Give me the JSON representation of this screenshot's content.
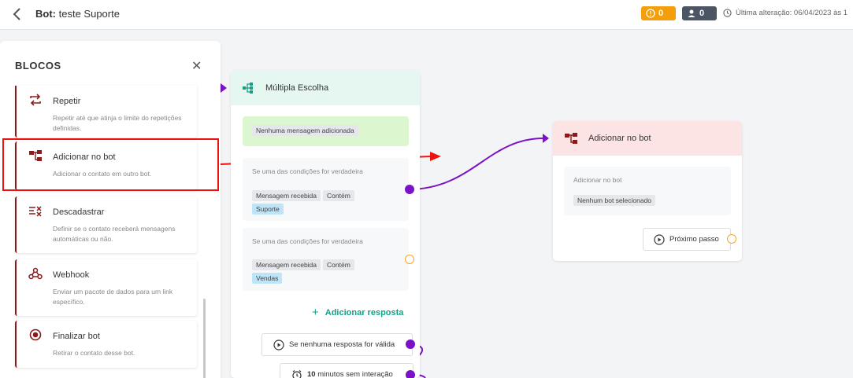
{
  "header": {
    "bot_prefix": "Bot:",
    "bot_name": "teste Suporte",
    "warnings_count": "0",
    "users_count": "0",
    "last_change": "Última alteração: 06/04/2023 às 1"
  },
  "sidebar": {
    "title": "BLOCOS",
    "items": [
      {
        "title": "Repetir",
        "desc": "Repetir até que atinja o limite do repetições definidas.",
        "icon": "repeat-icon"
      },
      {
        "title": "Adicionar no bot",
        "desc": "Adicionar o contato em outro bot.",
        "icon": "add-to-bot-icon"
      },
      {
        "title": "Descadastrar",
        "desc": "Definir se o contato receberá mensagens automáticas ou não.",
        "icon": "unsubscribe-icon"
      },
      {
        "title": "Webhook",
        "desc": "Enviar um pacote de dados para um link específico.",
        "icon": "webhook-icon"
      },
      {
        "title": "Finalizar bot",
        "desc": "Retirar o contato desse bot.",
        "icon": "stop-icon"
      }
    ]
  },
  "multiple_choice": {
    "title": "Múltipla Escolha",
    "no_message": "Nenhuma mensagem adicionada",
    "conditions": [
      {
        "label": "Se uma das condições for verdadeira",
        "tags": [
          "Mensagem recebida",
          "Contém"
        ],
        "value": "Suporte"
      },
      {
        "label": "Se uma das condições for verdadeira",
        "tags": [
          "Mensagem recebida",
          "Contém"
        ],
        "value": "Vendas"
      }
    ],
    "add_response": "Adicionar resposta",
    "no_valid_response": "Se nenhuma resposta for válida",
    "timeout": "10",
    "timeout_rest": "minutos sem interação"
  },
  "add_to_bot": {
    "title": "Adicionar no bot",
    "label": "Adicionar no bot",
    "value": "Nenhum bot selecionado",
    "next_step": "Próximo passo"
  },
  "colors": {
    "accent_purple": "#7c12c8",
    "green": "#16a085",
    "dark_red": "#8b1a1a",
    "highlight": "#ee1111"
  }
}
